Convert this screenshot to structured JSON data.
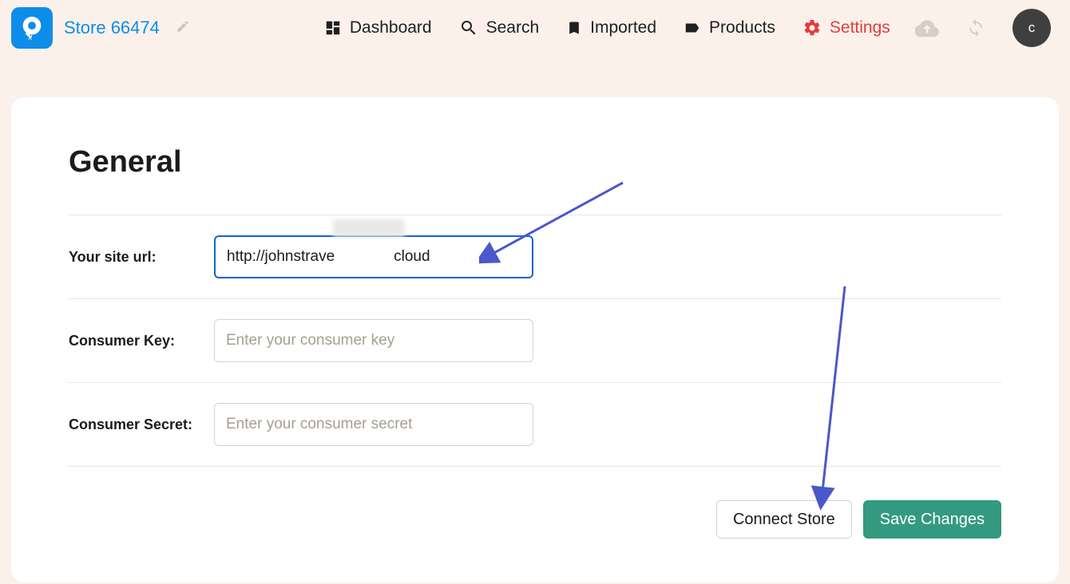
{
  "header": {
    "store_name": "Store 66474",
    "nav": [
      {
        "label": "Dashboard"
      },
      {
        "label": "Search"
      },
      {
        "label": "Imported"
      },
      {
        "label": "Products"
      },
      {
        "label": "Settings"
      }
    ],
    "avatar_letter": "c"
  },
  "page": {
    "title": "General",
    "site_url_label": "Your site url:",
    "site_url_value": "http://johnstrave              cloud",
    "consumer_key_label": "Consumer Key:",
    "consumer_key_placeholder": "Enter your consumer key",
    "consumer_secret_label": "Consumer Secret:",
    "consumer_secret_placeholder": "Enter your consumer secret",
    "connect_button": "Connect Store",
    "save_button": "Save Changes"
  }
}
